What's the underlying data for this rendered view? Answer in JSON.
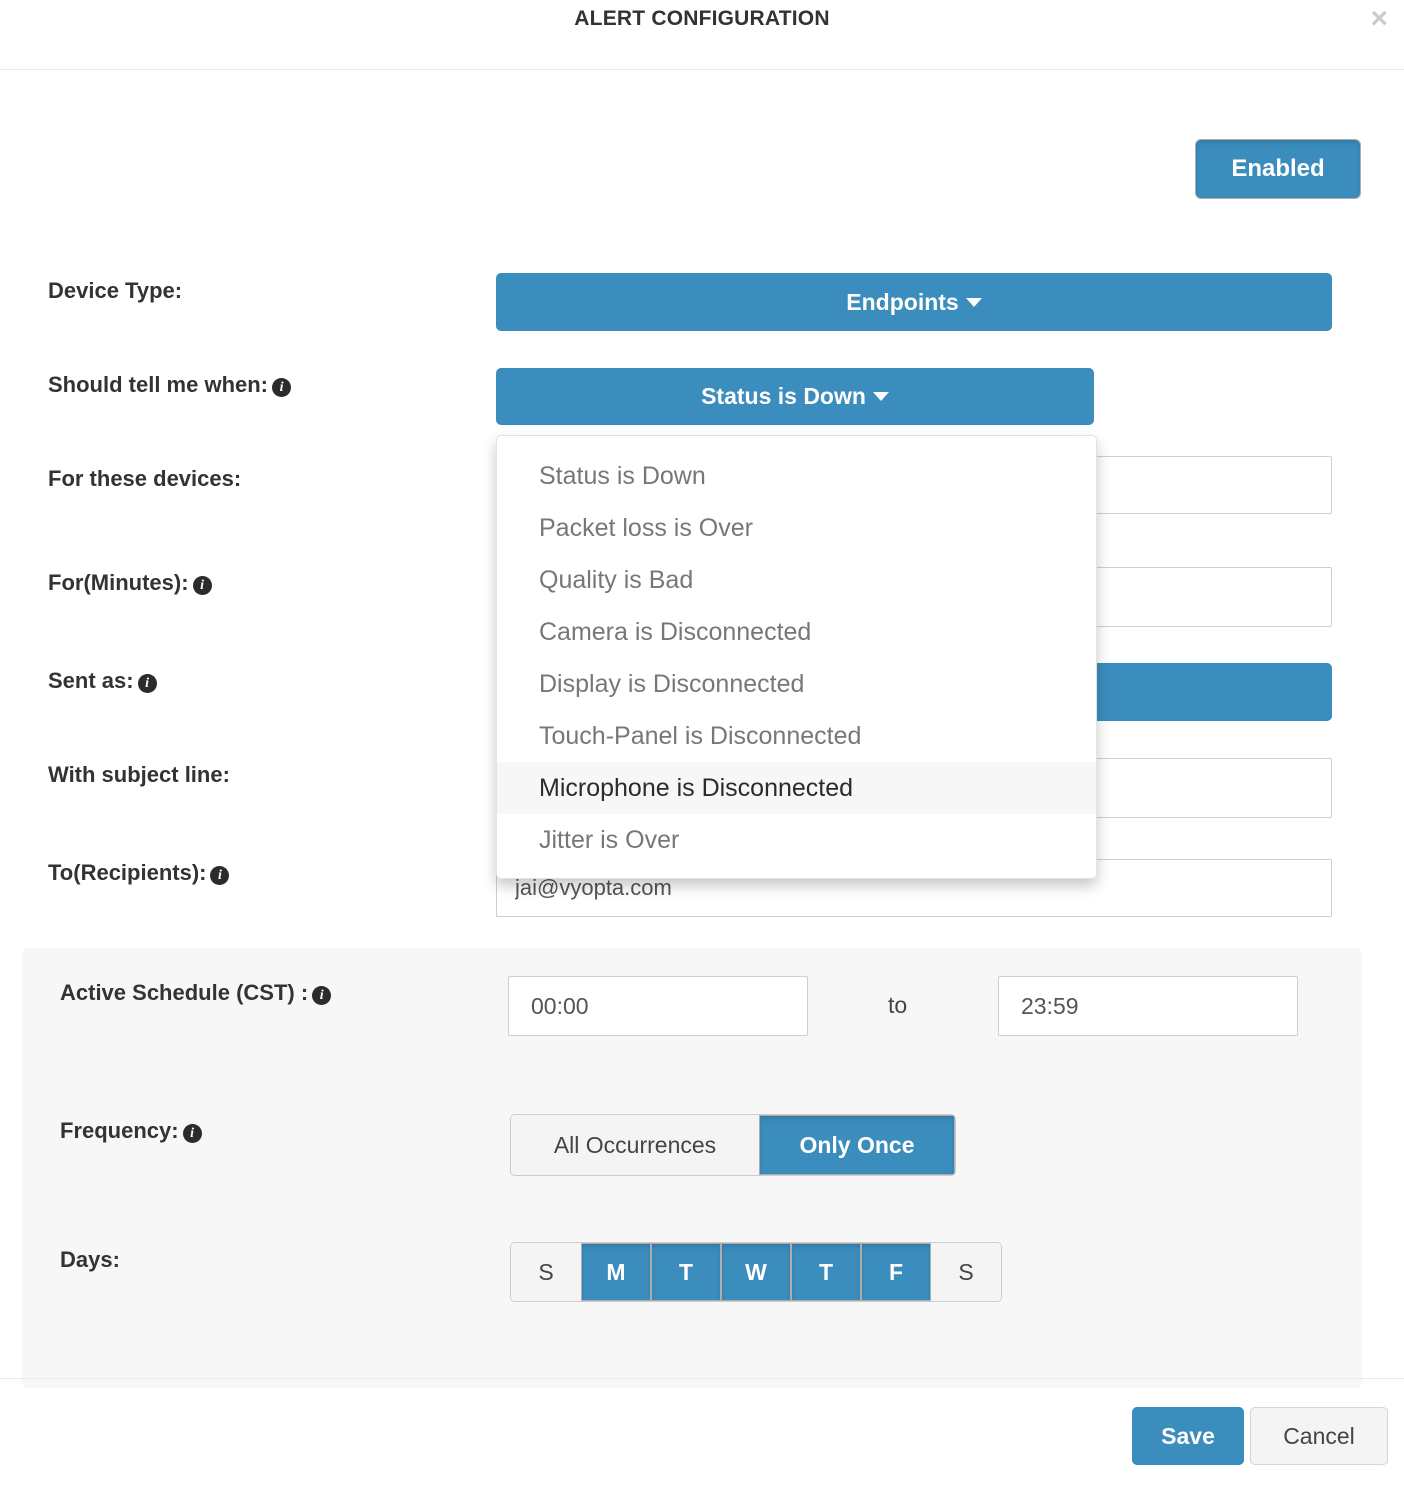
{
  "header": {
    "title": "ALERT CONFIGURATION",
    "close_icon": "close-icon",
    "close_glyph": "×"
  },
  "toggle": {
    "enabled_label": "Enabled"
  },
  "fields": {
    "device_type": {
      "label": "Device Type:",
      "value": "Endpoints"
    },
    "should_tell_me_when": {
      "label": "Should tell me when:",
      "value": "Status is Down",
      "has_info": true
    },
    "for_these_devices": {
      "label": "For these devices:",
      "value": "",
      "placeholder": ""
    },
    "for_minutes": {
      "label": "For(Minutes):",
      "value": "",
      "placeholder": "",
      "has_info": true
    },
    "sent_as": {
      "label": "Sent as:",
      "value": "",
      "has_info": true
    },
    "with_subject_line": {
      "label": "With subject line:",
      "value": "",
      "placeholder": ""
    },
    "to_recipients": {
      "label": "To(Recipients):",
      "value": "jai@vyopta.com",
      "placeholder": "",
      "has_info": true
    }
  },
  "dropdown": {
    "open": true,
    "items": [
      {
        "label": "Status is Down",
        "highlighted": false
      },
      {
        "label": "Packet loss is Over",
        "highlighted": false
      },
      {
        "label": "Quality is Bad",
        "highlighted": false
      },
      {
        "label": "Camera is Disconnected",
        "highlighted": false
      },
      {
        "label": "Display is Disconnected",
        "highlighted": false
      },
      {
        "label": "Touch-Panel is Disconnected",
        "highlighted": false
      },
      {
        "label": "Microphone is Disconnected",
        "highlighted": true
      },
      {
        "label": "Jitter is Over",
        "highlighted": false
      }
    ]
  },
  "schedule": {
    "active_schedule_label": "Active Schedule (CST) :",
    "start_time": "00:00",
    "to_text": "to",
    "end_time": "23:59",
    "frequency_label": "Frequency:",
    "frequency_options": [
      {
        "label": "All Occurrences",
        "active": false
      },
      {
        "label": "Only Once",
        "active": true
      }
    ],
    "days_label": "Days:",
    "days": [
      {
        "label": "S",
        "active": false
      },
      {
        "label": "M",
        "active": true
      },
      {
        "label": "T",
        "active": true
      },
      {
        "label": "W",
        "active": true
      },
      {
        "label": "T",
        "active": true
      },
      {
        "label": "F",
        "active": true
      },
      {
        "label": "S",
        "active": false
      }
    ]
  },
  "footer": {
    "save_label": "Save",
    "cancel_label": "Cancel"
  },
  "colors": {
    "accent": "#3b8dbd",
    "panel_bg": "#f7f7f7",
    "border": "#c8d0da",
    "text": "#333333"
  }
}
